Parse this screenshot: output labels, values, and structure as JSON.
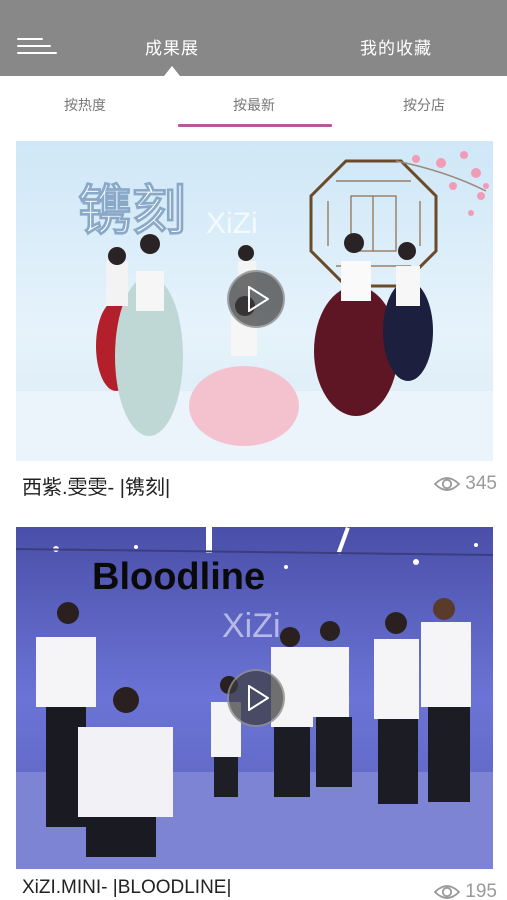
{
  "header": {
    "tabs": [
      {
        "label": "成果展",
        "active": true
      },
      {
        "label": "我的收藏",
        "active": false
      }
    ]
  },
  "subtabs": [
    {
      "label": "按热度",
      "active": false
    },
    {
      "label": "按最新",
      "active": true
    },
    {
      "label": "按分店",
      "active": false
    }
  ],
  "videos": [
    {
      "title": "西紫.雯雯- |镌刻|",
      "views": "345",
      "overlay_text": "镌刻",
      "watermark": "XiZi"
    },
    {
      "title": "XiZI.MINI- |BLOODLINE|",
      "views": "195",
      "overlay_text": "Bloodline",
      "watermark": "XiZi"
    }
  ],
  "colors": {
    "topbar": "#888888",
    "accent_underline": "#b55aa0",
    "views_text": "#9a9a9a"
  }
}
